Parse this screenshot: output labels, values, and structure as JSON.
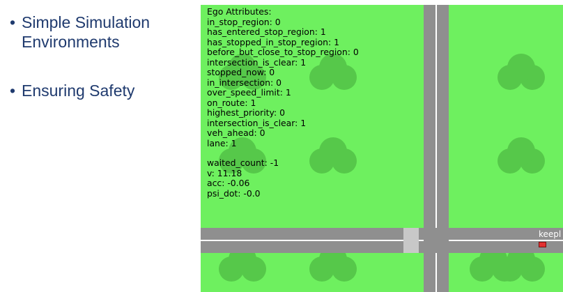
{
  "slide": {
    "bullet_glyph": "•",
    "bullets": [
      {
        "line1": "Simple Simulation",
        "line2": "Environments"
      },
      {
        "line1": "Ensuring Safety"
      }
    ]
  },
  "simulation": {
    "colors": {
      "grass": "#6ef05f",
      "tree": "#56c84a",
      "road": "#8f8f8f",
      "lane": "#ffffff",
      "car": "#e23030"
    },
    "ego_attributes_title": "Ego Attributes:",
    "attributes": [
      "in_stop_region: 0",
      "has_entered_stop_region: 1",
      "has_stopped_in_stop_region: 1",
      "before_but_close_to_stop_region: 0",
      "intersection_is_clear: 1",
      "stopped_now: 0",
      "in_intersection: 0",
      "over_speed_limit: 1",
      "on_route: 1",
      "highest_priority: 0",
      "intersection_is_clear: 1",
      "veh_ahead: 0",
      "lane: 1"
    ],
    "stats": [
      "waited_count: -1",
      "v: 11.18",
      "acc: -0.06",
      "psi_dot: -0.0"
    ],
    "road_label": "keepl"
  }
}
